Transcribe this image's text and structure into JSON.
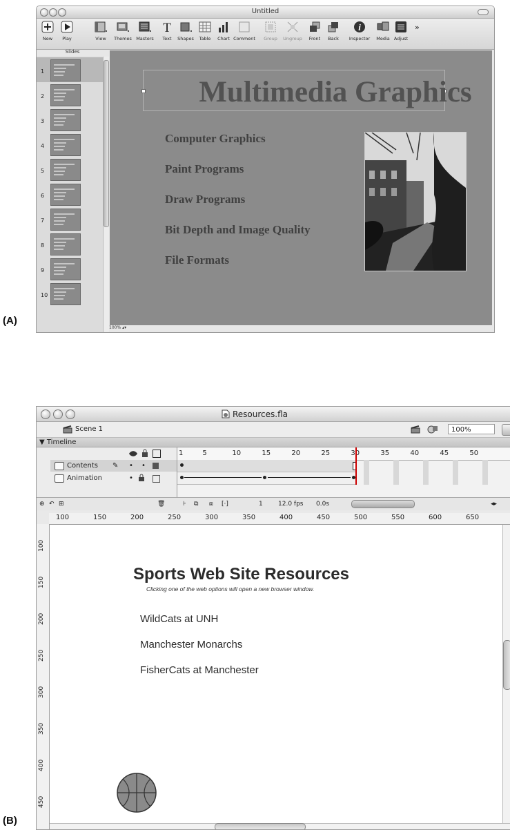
{
  "labels": {
    "a": "(A)",
    "b": "(B)"
  },
  "keynote": {
    "window_title": "Untitled",
    "toolbar": [
      {
        "label": "New",
        "icon": "plus-icon"
      },
      {
        "label": "Play",
        "icon": "play-icon"
      },
      {
        "label": "View",
        "icon": "view-icon"
      },
      {
        "label": "Themes",
        "icon": "themes-icon"
      },
      {
        "label": "Masters",
        "icon": "masters-icon"
      },
      {
        "label": "Text",
        "icon": "text-icon"
      },
      {
        "label": "Shapes",
        "icon": "shapes-icon"
      },
      {
        "label": "Table",
        "icon": "table-icon"
      },
      {
        "label": "Chart",
        "icon": "chart-icon"
      },
      {
        "label": "Comment",
        "icon": "comment-icon"
      },
      {
        "label": "Group",
        "icon": "group-icon"
      },
      {
        "label": "Ungroup",
        "icon": "ungroup-icon"
      },
      {
        "label": "Front",
        "icon": "front-icon"
      },
      {
        "label": "Back",
        "icon": "back-icon"
      },
      {
        "label": "Inspector",
        "icon": "inspector-icon"
      },
      {
        "label": "Media",
        "icon": "media-icon"
      },
      {
        "label": "Adjust",
        "icon": "adjust-icon"
      }
    ],
    "overflow": "»",
    "slides_header": "Slides",
    "slide_numbers": [
      "1",
      "2",
      "3",
      "4",
      "5",
      "6",
      "7",
      "8",
      "9",
      "10"
    ],
    "selected_slide": "1",
    "zoom": "100%",
    "slide": {
      "title": "Multimedia Graphics",
      "bullets": [
        "Computer Graphics",
        "Paint Programs",
        "Draw Programs",
        "Bit Depth and Image Quality",
        "File Formats"
      ]
    }
  },
  "flash": {
    "window_title": "Resources.fla",
    "scene": "Scene 1",
    "zoom": "100%",
    "timeline_label": "Timeline",
    "layers": [
      {
        "name": "Contents"
      },
      {
        "name": "Animation"
      }
    ],
    "frame_numbers": [
      "1",
      "5",
      "10",
      "15",
      "20",
      "25",
      "30",
      "35",
      "40",
      "45",
      "50"
    ],
    "status": {
      "frame": "1",
      "fps": "12.0 fps",
      "time": "0.0s"
    },
    "h_ruler": [
      "100",
      "150",
      "200",
      "250",
      "300",
      "350",
      "400",
      "450",
      "500",
      "550",
      "600",
      "650"
    ],
    "v_ruler": [
      "100",
      "150",
      "200",
      "250",
      "300",
      "350",
      "400",
      "450"
    ],
    "stage": {
      "title": "Sports Web Site Resources",
      "subtitle": "Clicking one of the web options will open a new browser window.",
      "links": [
        "WildCats at UNH",
        "Manchester Monarchs",
        "FisherCats at Manchester"
      ]
    }
  }
}
